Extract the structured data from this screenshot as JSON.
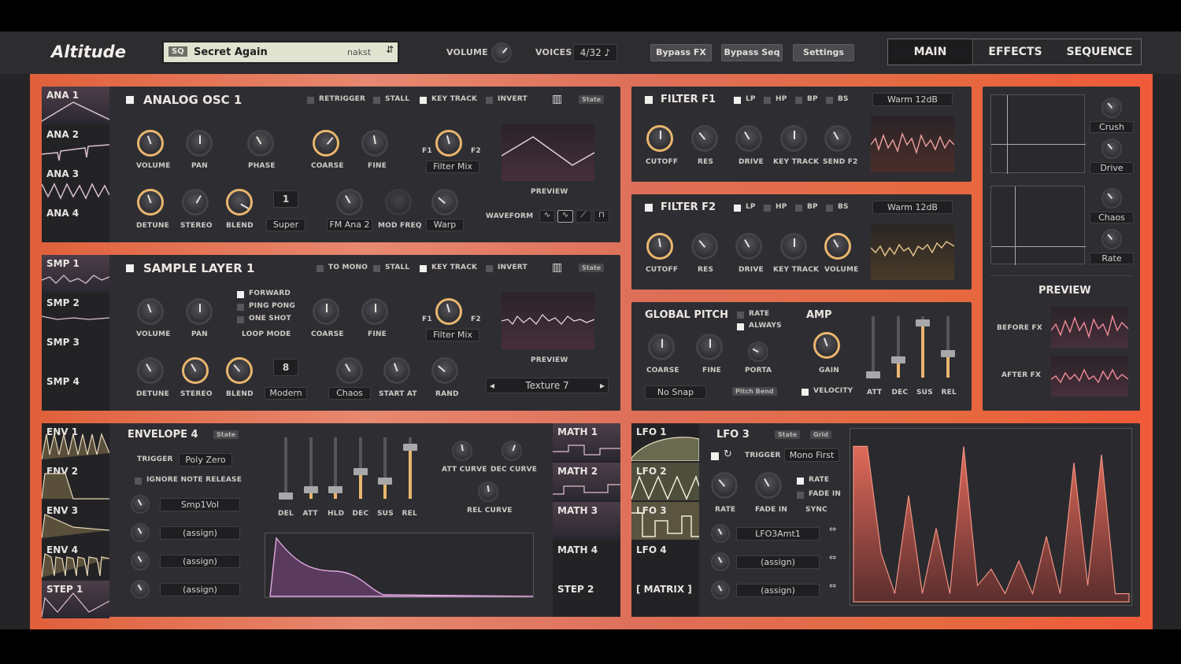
{
  "app": {
    "name": "Altitude",
    "volume_label": "VOLUME",
    "voices_label": "VOICES",
    "voices_value": "4/32"
  },
  "preset": {
    "badge": "SQ",
    "name": "Secret Again",
    "author": "nakst"
  },
  "toolbar": {
    "bypass_fx": "Bypass FX",
    "bypass_seq": "Bypass Seq",
    "settings": "Settings"
  },
  "tabs": [
    "MAIN",
    "EFFECTS",
    "SEQUENCE"
  ],
  "osc_side": [
    "ANA 1",
    "ANA 2",
    "ANA 3",
    "ANA 4"
  ],
  "sample_side": [
    "SMP 1",
    "SMP 2",
    "SMP 3",
    "SMP 4"
  ],
  "osc": {
    "title": "ANALOG OSC 1",
    "flags": [
      "RETRIGGER",
      "STALL",
      "KEY TRACK",
      "INVERT"
    ],
    "state": "State",
    "knobs1": [
      "VOLUME",
      "PAN",
      "PHASE",
      "COARSE",
      "FINE"
    ],
    "filter_mix": "Filter Mix",
    "f1": "F1",
    "f2": "F2",
    "knobs2": [
      "DETUNE",
      "STEREO",
      "BLEND"
    ],
    "voices": "1",
    "mode": "Super",
    "mod1": "FM Ana 2",
    "mod2": "MOD FREQ",
    "warp": "Warp",
    "preview": "PREVIEW",
    "waveform": "WAVEFORM"
  },
  "sample": {
    "title": "SAMPLE LAYER 1",
    "flags": [
      "TO MONO",
      "STALL",
      "KEY TRACK",
      "INVERT"
    ],
    "state": "State",
    "knobs1": [
      "VOLUME",
      "PAN"
    ],
    "loop_options": [
      "FORWARD",
      "PING PONG",
      "ONE SHOT"
    ],
    "loop_mode": "LOOP MODE",
    "coarse": "COARSE",
    "fine": "FINE",
    "filter_mix": "Filter Mix",
    "f1": "F1",
    "f2": "F2",
    "knobs2": [
      "DETUNE",
      "STEREO",
      "BLEND"
    ],
    "voices": "8",
    "mode": "Modern",
    "chaos": "Chaos",
    "start_at": "START AT",
    "rand": "RAND",
    "preview": "PREVIEW",
    "texture": "Texture 7"
  },
  "filter1": {
    "title": "FILTER F1",
    "types": [
      "LP",
      "HP",
      "BP",
      "BS"
    ],
    "model": "Warm 12dB",
    "knobs": [
      "CUTOFF",
      "RES",
      "DRIVE",
      "KEY TRACK",
      "SEND F2"
    ]
  },
  "filter2": {
    "title": "FILTER F2",
    "types": [
      "LP",
      "HP",
      "BP",
      "BS"
    ],
    "model": "Warm 12dB",
    "knobs": [
      "CUTOFF",
      "RES",
      "DRIVE",
      "KEY TRACK",
      "VOLUME"
    ]
  },
  "pitch": {
    "title": "GLOBAL PITCH",
    "rate": "RATE",
    "always": "ALWAYS",
    "knobs": [
      "COARSE",
      "FINE",
      "PORTA"
    ],
    "snap": "No Snap",
    "pitch_bend": "Pitch Bend"
  },
  "amp": {
    "title": "AMP",
    "gain": "GAIN",
    "velocity": "VELOCITY",
    "faders": [
      "ATT",
      "DEC",
      "SUS",
      "REL"
    ],
    "fader_levels": [
      0.05,
      0.3,
      0.9,
      0.4
    ]
  },
  "fx": {
    "crush": "Crush",
    "drive": "Drive",
    "chaos": "Chaos",
    "rate": "Rate",
    "preview": "PREVIEW",
    "before": "BEFORE FX",
    "after": "AFTER FX"
  },
  "env_side": [
    "ENV 1",
    "ENV 2",
    "ENV 3",
    "ENV 4",
    "STEP 1"
  ],
  "env": {
    "title": "ENVELOPE 4",
    "state": "State",
    "trigger_label": "TRIGGER",
    "trigger": "Poly Zero",
    "ignore": "IGNORE NOTE RELEASE",
    "mods": [
      "Smp1Vol",
      "(assign)",
      "(assign)",
      "(assign)"
    ],
    "faders": [
      "DEL",
      "ATT",
      "HLD",
      "DEC",
      "SUS",
      "REL"
    ],
    "fader_levels": [
      0.05,
      0.15,
      0.15,
      0.45,
      0.3,
      0.85
    ],
    "att_curve": "ATT CURVE",
    "dec_curve": "DEC CURVE",
    "rel_curve": "REL CURVE"
  },
  "math_side": [
    "MATH 1",
    "MATH 2",
    "MATH 3",
    "MATH 4",
    "STEP 2"
  ],
  "lfo_side": [
    "LFO 1",
    "LFO 2",
    "LFO 3",
    "LFO 4",
    "[ MATRIX ]"
  ],
  "lfo": {
    "title": "LFO 3",
    "state": "State",
    "grid": "Grid",
    "trigger_label": "TRIGGER",
    "trigger": "Mono First",
    "rate": "RATE",
    "fade_in": "FADE IN",
    "knobs": [
      "RATE",
      "FADE IN",
      "SYNC"
    ],
    "mods": [
      "LFO3Amt1",
      "(assign)",
      "(assign)"
    ],
    "steps": [
      0.95,
      0.95,
      0.3,
      0.05,
      0.65,
      0.05,
      0.45,
      0.05,
      0.95,
      0.1,
      0.2,
      0.05,
      0.25,
      0.05,
      0.4,
      0.05,
      0.85,
      0.1,
      0.9,
      0.05,
      0.05
    ]
  },
  "colors": {
    "accent": "#e9b66e",
    "frame": "#e07050"
  }
}
